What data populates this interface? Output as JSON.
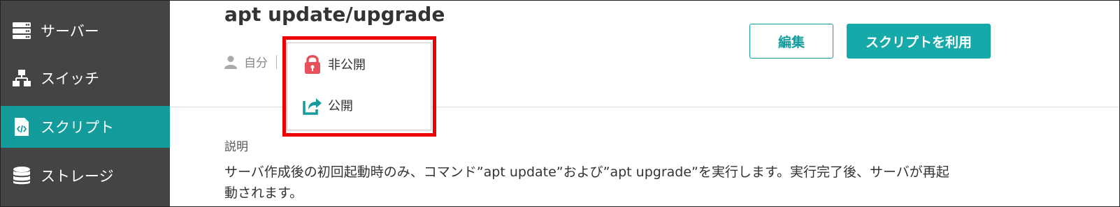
{
  "sidebar": {
    "items": [
      {
        "label": "サーバー",
        "icon": "server-icon"
      },
      {
        "label": "スイッチ",
        "icon": "network-switch-icon"
      },
      {
        "label": "スクリプト",
        "icon": "script-file-icon",
        "active": true
      },
      {
        "label": "ストレージ",
        "icon": "storage-icon"
      }
    ]
  },
  "main": {
    "title": "apt update/upgrade",
    "owner": "自分",
    "edit_label": "編集",
    "use_label": "スクリプトを利用",
    "description_label": "説明",
    "description": "サーバ作成後の初回起動時のみ、コマンド”apt update”および”apt upgrade”を実行します。実行完了後、サーバが再起動されます。"
  },
  "visibility_menu": {
    "items": [
      {
        "label": "非公開",
        "icon": "lock-icon"
      },
      {
        "label": "公開",
        "icon": "share-icon"
      }
    ]
  },
  "colors": {
    "sidebar_bg": "#444444",
    "accent": "#149c9c",
    "highlight": "#ee0000",
    "lock": "#e8505b"
  }
}
